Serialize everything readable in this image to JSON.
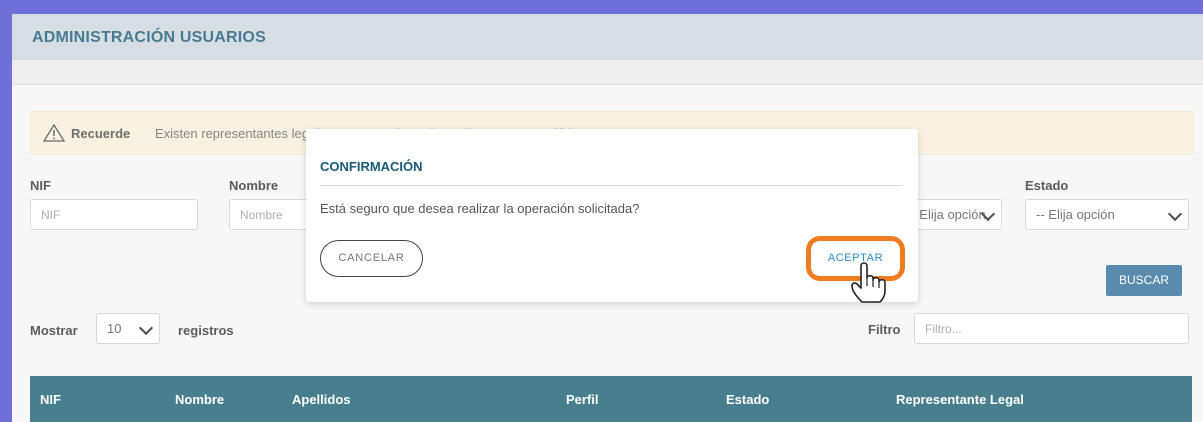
{
  "header": {
    "title": "ADMINISTRACIÓN USUARIOS"
  },
  "alert": {
    "icon": "warning-icon",
    "strong": "Recuerde",
    "text": "Existen representantes legales cuyo estado está pendiente o no es válido."
  },
  "filters": {
    "nif_label": "NIF",
    "nif_placeholder": "NIF",
    "nombre_label": "Nombre",
    "nombre_placeholder": "Nombre",
    "hidden_select_value": "-- Elija opción",
    "estado_label": "Estado",
    "estado_value": "-- Elija opción",
    "search_button": "BUSCAR"
  },
  "paging": {
    "show_label": "Mostrar",
    "page_size": "10",
    "records_label": "registros",
    "filter_label": "Filtro",
    "filter_placeholder": "Filtro..."
  },
  "table": {
    "columns": [
      "NIF",
      "Nombre",
      "Apellidos",
      "Perfil",
      "Estado",
      "Representante Legal"
    ]
  },
  "dialog": {
    "title": "CONFIRMACIÓN",
    "message": "Está seguro que desea realizar la operación solicitada?",
    "cancel": "CANCELAR",
    "accept": "ACEPTAR"
  },
  "colors": {
    "border": "#4a4dcf",
    "header_text": "#1a5b78",
    "table_header": "#1a5f73",
    "search_button": "#2f6f9a",
    "highlight": "#f07c22",
    "accept_text": "#2b8bd3"
  }
}
